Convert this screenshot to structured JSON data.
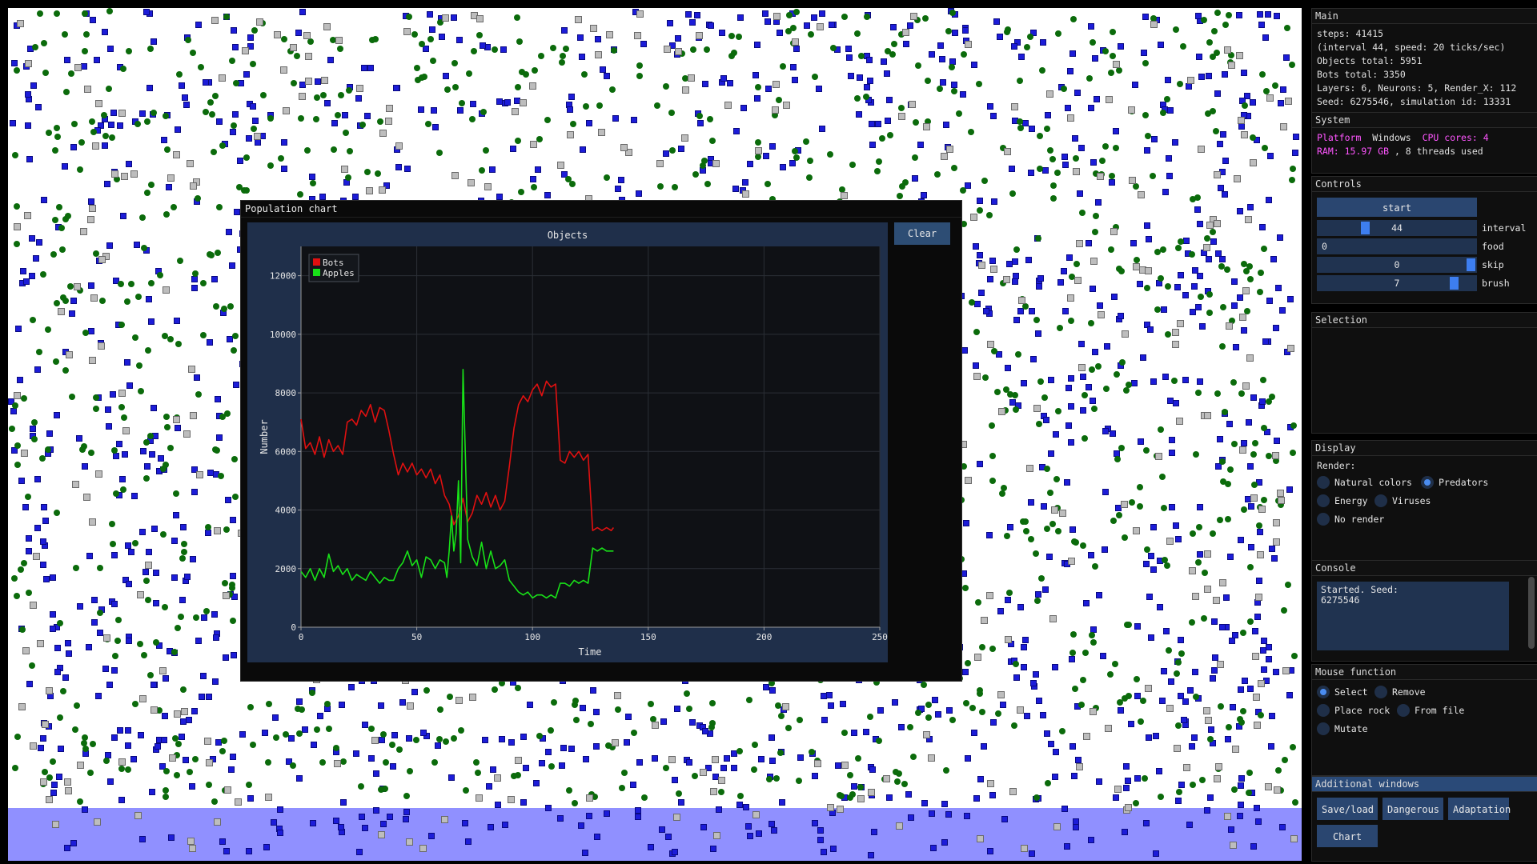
{
  "chart_window": {
    "title": "Population chart",
    "clear_label": "Clear"
  },
  "chart_data": {
    "type": "line",
    "title": "Objects",
    "xlabel": "Time",
    "ylabel": "Number",
    "xlim": [
      0,
      250
    ],
    "ylim": [
      0,
      13000
    ],
    "xticks": [
      0,
      50,
      100,
      150,
      200,
      250
    ],
    "yticks": [
      0,
      2000,
      4000,
      6000,
      8000,
      10000,
      12000
    ],
    "grid": true,
    "legend_position": "top-left",
    "series": [
      {
        "name": "Bots",
        "color": "#e01010",
        "x": [
          0,
          2,
          4,
          6,
          8,
          10,
          12,
          14,
          16,
          18,
          20,
          22,
          24,
          26,
          28,
          30,
          32,
          34,
          36,
          38,
          40,
          42,
          44,
          46,
          48,
          50,
          52,
          54,
          56,
          58,
          60,
          62,
          64,
          66,
          68,
          70,
          72,
          74,
          76,
          78,
          80,
          82,
          84,
          86,
          88,
          90,
          92,
          94,
          96,
          98,
          100,
          102,
          104,
          106,
          108,
          110,
          112,
          114,
          116,
          118,
          120,
          122,
          124,
          126,
          128,
          130,
          132,
          134,
          135
        ],
        "values": [
          7100,
          6100,
          6300,
          5900,
          6500,
          5800,
          6400,
          6000,
          6200,
          5900,
          7000,
          7100,
          6900,
          7400,
          7200,
          7600,
          7000,
          7500,
          7400,
          6700,
          5900,
          5200,
          5600,
          5300,
          5600,
          5200,
          5400,
          5100,
          5400,
          4900,
          5200,
          4500,
          4200,
          3500,
          3800,
          4400,
          3600,
          3900,
          4500,
          4200,
          4600,
          4100,
          4500,
          4000,
          4300,
          5500,
          6800,
          7600,
          7900,
          7700,
          8100,
          8300,
          7900,
          8400,
          8200,
          8300,
          5700,
          5600,
          6000,
          5800,
          6000,
          5700,
          5900,
          3300,
          3400,
          3300,
          3400,
          3300,
          3400
        ]
      },
      {
        "name": "Apples",
        "color": "#18e018",
        "x": [
          0,
          2,
          4,
          6,
          8,
          10,
          12,
          14,
          16,
          18,
          20,
          22,
          24,
          26,
          28,
          30,
          32,
          34,
          36,
          38,
          40,
          42,
          44,
          46,
          48,
          50,
          52,
          54,
          56,
          58,
          60,
          62,
          63,
          64,
          65,
          66,
          67,
          68,
          69,
          70,
          72,
          74,
          76,
          78,
          80,
          82,
          84,
          86,
          88,
          90,
          92,
          94,
          96,
          98,
          100,
          102,
          104,
          106,
          108,
          110,
          112,
          114,
          116,
          118,
          120,
          122,
          124,
          126,
          128,
          130,
          132,
          134,
          135
        ],
        "values": [
          1900,
          1700,
          2000,
          1600,
          2000,
          1700,
          2500,
          1900,
          2100,
          1800,
          2000,
          1600,
          1800,
          1700,
          1600,
          1900,
          1700,
          1500,
          1700,
          1600,
          1600,
          2000,
          2200,
          2600,
          2100,
          2300,
          1700,
          2400,
          2300,
          2000,
          2300,
          2200,
          1700,
          2600,
          3800,
          2600,
          3200,
          5000,
          2200,
          8800,
          3000,
          2400,
          2100,
          2900,
          2000,
          2600,
          2000,
          2100,
          2300,
          1600,
          1400,
          1200,
          1100,
          1200,
          1000,
          1100,
          1100,
          1000,
          1100,
          1000,
          1500,
          1500,
          1400,
          1600,
          1500,
          1600,
          1500,
          2700,
          2600,
          2700,
          2600,
          2600,
          2600
        ]
      }
    ]
  },
  "sidebar": {
    "main": {
      "title": "Main",
      "lines": [
        "steps: 41415",
        "(interval 44, speed: 20 ticks/sec)",
        "Objects total: 5951",
        "Bots total: 3350",
        "Layers: 6, Neurons: 5, Render_X: 112",
        "Seed: 6275546, simulation id: 13331"
      ]
    },
    "system": {
      "title": "System",
      "platform_label": "Platform",
      "platform_value": "Windows",
      "cpu_label": "CPU cores: 4",
      "ram_label": "RAM: 15.97 GB",
      "threads_text": ", 8 threads used"
    },
    "controls": {
      "title": "Controls",
      "start_label": "start",
      "interval_value": "44",
      "interval_label": "interval",
      "interval_fraction": 0.29,
      "food_value": "0",
      "food_label": "food",
      "skip_value": "0",
      "skip_label": "skip",
      "brush_value": "7",
      "brush_label": "brush"
    },
    "selection": {
      "title": "Selection"
    },
    "display": {
      "title": "Display",
      "render_label": "Render:",
      "options": [
        "Natural colors",
        "Predators",
        "Energy",
        "Viruses",
        "No render"
      ],
      "selected": "Predators"
    },
    "console": {
      "title": "Console",
      "text": "Started. Seed:\n6275546"
    },
    "mouse": {
      "title": "Mouse function",
      "options": [
        "Select",
        "Remove",
        "Place rock",
        "From file",
        "Mutate"
      ],
      "selected": "Select"
    },
    "additional": {
      "title": "Additional windows",
      "buttons": [
        "Save/load",
        "Dangerous",
        "Adaptation",
        "Chart"
      ]
    }
  }
}
